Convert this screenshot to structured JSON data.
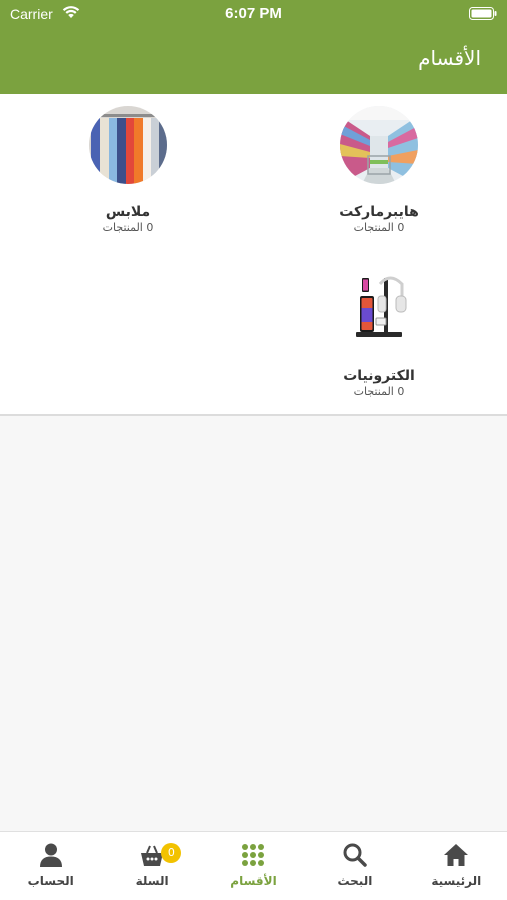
{
  "status_bar": {
    "carrier": "Carrier",
    "time": "6:07 PM"
  },
  "header": {
    "title": "الأقسام"
  },
  "categories": [
    {
      "name": "هايبرماركت",
      "count": "0 المنتجات",
      "icon": "supermarket-aisle-image"
    },
    {
      "name": "ملابس",
      "count": "0 المنتجات",
      "icon": "clothes-rack-image"
    },
    {
      "name": "الكترونيات",
      "count": "0 المنتجات",
      "icon": "electronics-stand-image"
    }
  ],
  "tab_bar": {
    "items": [
      {
        "label": "الرئيسية",
        "icon": "home-icon"
      },
      {
        "label": "البحث",
        "icon": "search-icon"
      },
      {
        "label": "الأقسام",
        "icon": "grid-icon",
        "active": true
      },
      {
        "label": "السلة",
        "icon": "basket-icon",
        "badge": "0"
      },
      {
        "label": "الحساب",
        "icon": "user-icon"
      }
    ]
  },
  "colors": {
    "accent": "#7ba23f",
    "badge": "#f2c200"
  }
}
